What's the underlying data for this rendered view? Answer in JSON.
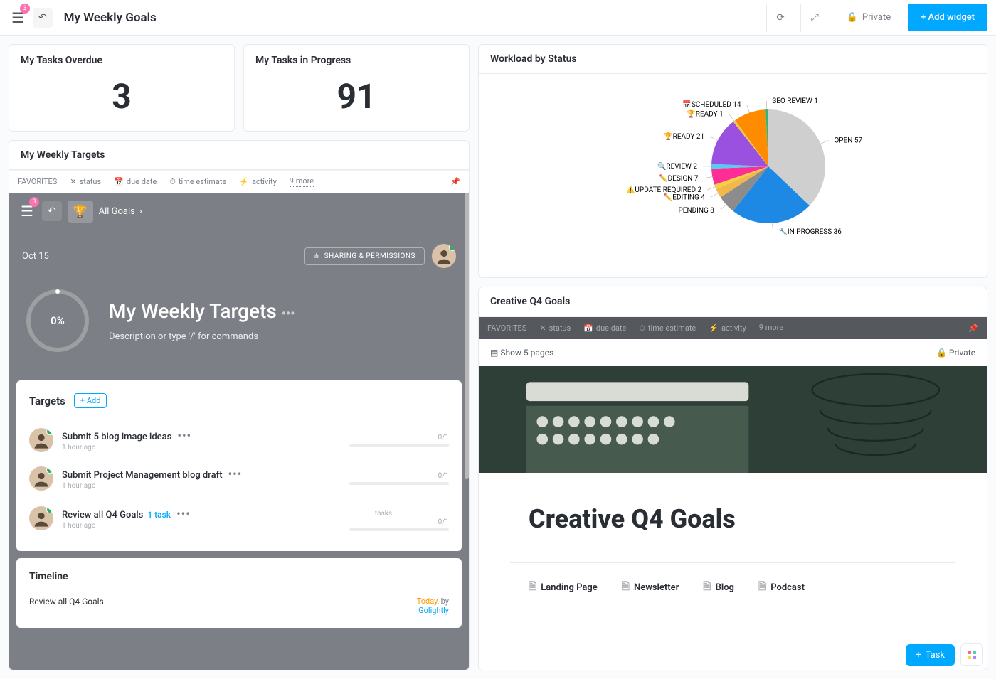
{
  "header": {
    "notification_count": "3",
    "title": "My Weekly Goals",
    "private": "Private",
    "add_widget": "+ Add widget"
  },
  "stats": {
    "overdue": {
      "title": "My Tasks Overdue",
      "value": "3"
    },
    "progress": {
      "title": "My Tasks in Progress",
      "value": "91"
    }
  },
  "weekly": {
    "card_title": "My Weekly Targets",
    "favorites": "FAVORITES",
    "cols": {
      "status": "status",
      "due": "due date",
      "time": "time estimate",
      "activity": "activity",
      "more": "9 more"
    },
    "all_goals": "All Goals",
    "notification_count": "3",
    "date": "Oct 15",
    "share": "SHARING & PERMISSIONS",
    "hero_title": "My Weekly Targets",
    "hero_desc": "Description or type '/' for commands",
    "progress": "0%",
    "targets_title": "Targets",
    "add": "+ Add",
    "items": [
      {
        "name": "Submit 5 blog image ideas",
        "sub": "1 hour ago",
        "prog": "0/1"
      },
      {
        "name": "Submit Project Management blog draft",
        "sub": "1 hour ago",
        "prog": "0/1"
      },
      {
        "name": "Review all Q4 Goals",
        "link": "1 task",
        "sub": "1 hour ago",
        "prog": "0/1",
        "label": "tasks"
      }
    ],
    "timeline": {
      "title": "Timeline",
      "item": "Review all Q4 Goals",
      "today": "Today",
      "by": ", by",
      "author": "Golightly"
    }
  },
  "workload": {
    "title": "Workload by Status"
  },
  "chart_data": {
    "type": "pie",
    "series": [
      {
        "name": "SEO REVIEW",
        "value": 1,
        "color": "#33b679"
      },
      {
        "name": "📅SCHEDULED",
        "value": 14,
        "color": "#ff8c00"
      },
      {
        "name": "🏆READY",
        "value": 1,
        "color": "#f2c94c"
      },
      {
        "name": "🏆READY",
        "value": 21,
        "color": "#9b51e0"
      },
      {
        "name": "🔍REVIEW",
        "value": 2,
        "color": "#56ccf2"
      },
      {
        "name": "✏️DESIGN",
        "value": 7,
        "color": "#ff2d96"
      },
      {
        "name": "⚠️UPDATE REQUIRED",
        "value": 2,
        "color": "#f5d142"
      },
      {
        "name": "✏️EDITING",
        "value": 4,
        "color": "#f2b84b"
      },
      {
        "name": "PENDING",
        "value": 8,
        "color": "#8c8c8c"
      },
      {
        "name": "🔧IN PROGRESS",
        "value": 36,
        "color": "#1e88e5"
      },
      {
        "name": "OPEN",
        "value": 57,
        "color": "#cfcfcf"
      }
    ]
  },
  "q4": {
    "card_title": "Creative Q4 Goals",
    "favorites": "FAVORITES",
    "cols": {
      "status": "status",
      "due": "due date",
      "time": "time estimate",
      "activity": "activity",
      "more": "9 more"
    },
    "show_pages": "Show 5 pages",
    "private": "Private",
    "h1": "Creative Q4 Goals",
    "links": [
      "Landing Page",
      "Newsletter",
      "Blog",
      "Podcast"
    ]
  },
  "fab": {
    "task": "Task"
  }
}
